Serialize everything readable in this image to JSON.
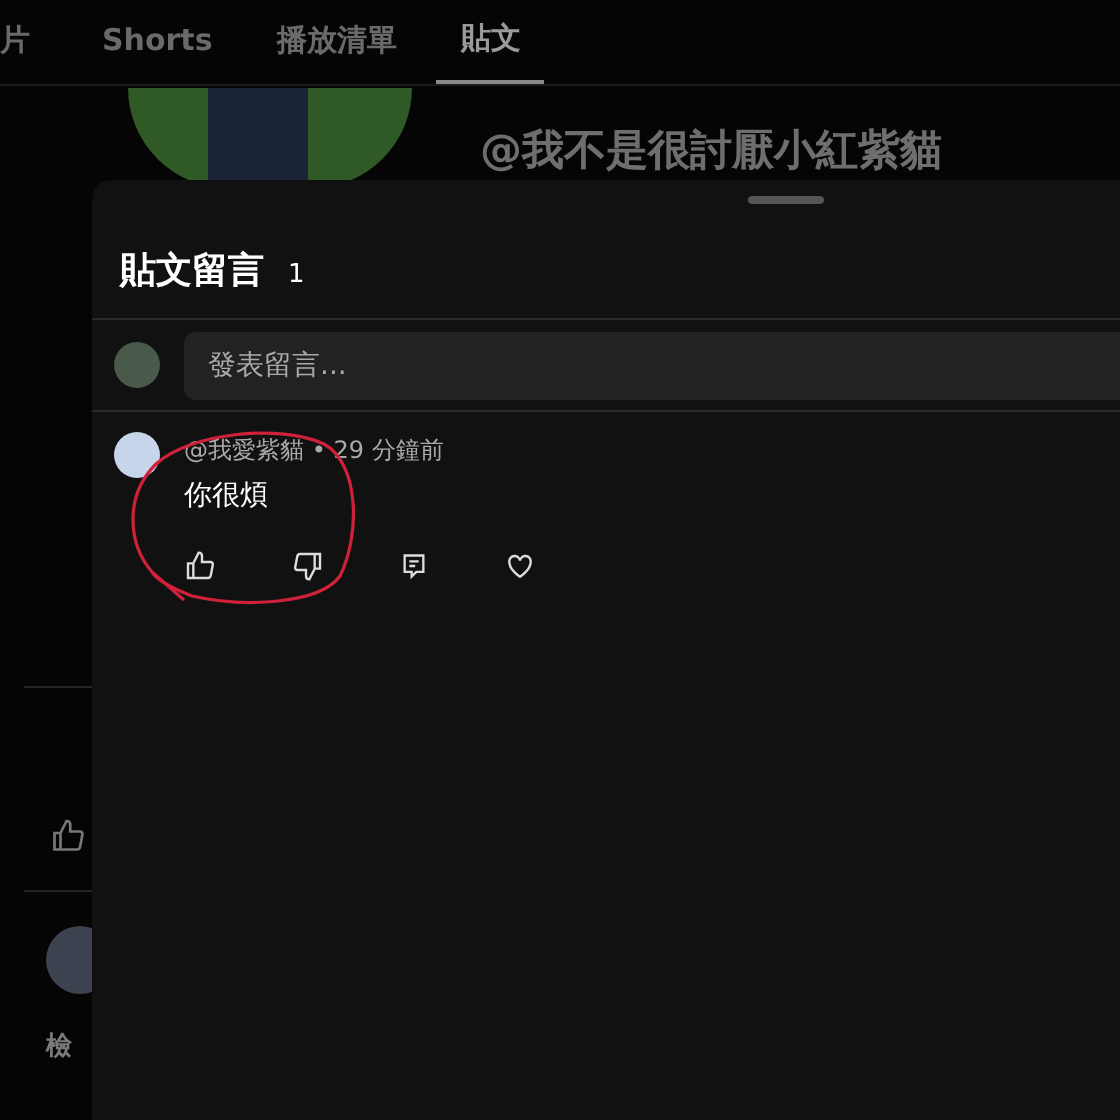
{
  "tabs": [
    {
      "label": "片",
      "selected": false
    },
    {
      "label": "Shorts",
      "selected": false
    },
    {
      "label": "播放清單",
      "selected": false
    },
    {
      "label": "貼文",
      "selected": true
    }
  ],
  "channel_handle": "@我不是很討厭小紅紫貓",
  "background_label": "檢",
  "comments_sheet": {
    "title": "貼文留言",
    "count": "1",
    "comment_field": {
      "placeholder": "發表留言..."
    },
    "comments": [
      {
        "meta": "@我愛紫貓 • 29 分鐘前",
        "text": "你很煩"
      }
    ]
  }
}
